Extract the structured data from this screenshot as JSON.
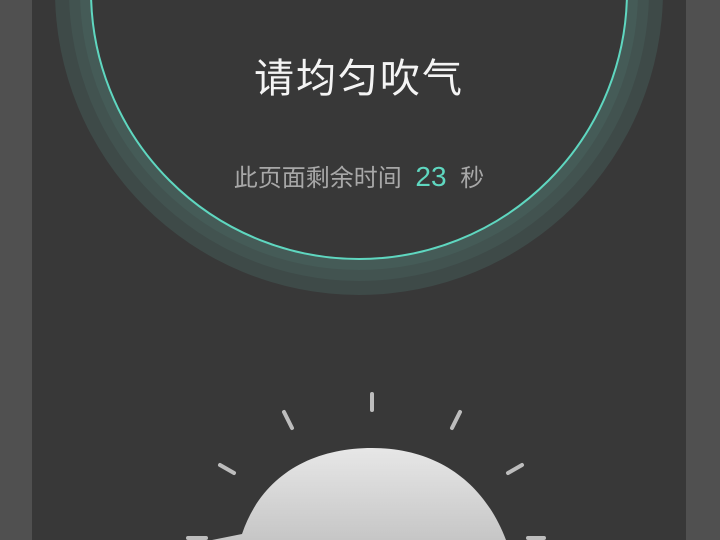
{
  "blow_screen": {
    "instruction": "请均匀吹气",
    "countdown_prefix": "此页面剩余时间",
    "countdown_seconds": "23",
    "countdown_unit": "秒"
  },
  "colors": {
    "background": "#383838",
    "accent": "#5fd7c0",
    "ring": "#455b57",
    "text_primary": "#f4f4f4",
    "text_secondary": "#a8a8a8"
  },
  "icons": {
    "speech_bubble": "speech-bubble-icon",
    "rays": "ray-lines-icon"
  }
}
